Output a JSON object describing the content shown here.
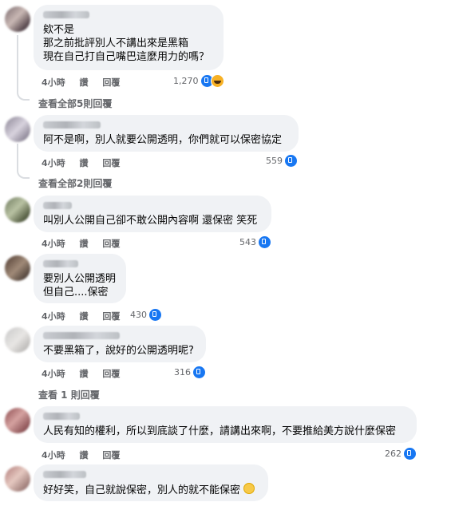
{
  "comments": [
    {
      "lines": [
        "欸不是",
        "那之前批評別人不講出來是黑箱",
        "現在自己打自己嘴巴這麼用力的嗎？"
      ],
      "time": "4小時",
      "like": "讚",
      "reply": "回覆",
      "count": "1,270",
      "more": "查看全部5則回覆"
    },
    {
      "lines": [
        "阿不是啊，別人就要公開透明，你們就可以保密協定"
      ],
      "time": "4小時",
      "like": "讚",
      "reply": "回覆",
      "count": "559",
      "more": "查看全部2則回覆"
    },
    {
      "lines": [
        "叫別人公開自己卻不敢公開內容啊 還保密 笑死"
      ],
      "time": "4小時",
      "like": "讚",
      "reply": "回覆",
      "count": "543"
    },
    {
      "lines": [
        "要別人公開透明",
        "但自己....保密"
      ],
      "time": "4小時",
      "like": "讚",
      "reply": "回覆",
      "count": "430"
    },
    {
      "lines": [
        "不要黑箱了，說好的公開透明呢?"
      ],
      "time": "4小時",
      "like": "讚",
      "reply": "回覆",
      "count": "316",
      "more": "查看 1 則回覆"
    },
    {
      "lines": [
        "人民有知的權利，所以到底談了什麼，請講出來啊，不要推給美方說什麼保密"
      ],
      "time": "4小時",
      "like": "讚",
      "reply": "回覆",
      "count": "262"
    },
    {
      "lines": [
        "好好笑，自己就說保密，別人的就不能保密"
      ]
    }
  ],
  "colors": {
    "bubble": "#f0f2f5",
    "meta": "#65676b",
    "like": "#1877f2",
    "text": "#050505"
  },
  "icons": {
    "like": "like-icon",
    "haha": "haha-icon",
    "emoji": "grimace-emoji-icon"
  }
}
